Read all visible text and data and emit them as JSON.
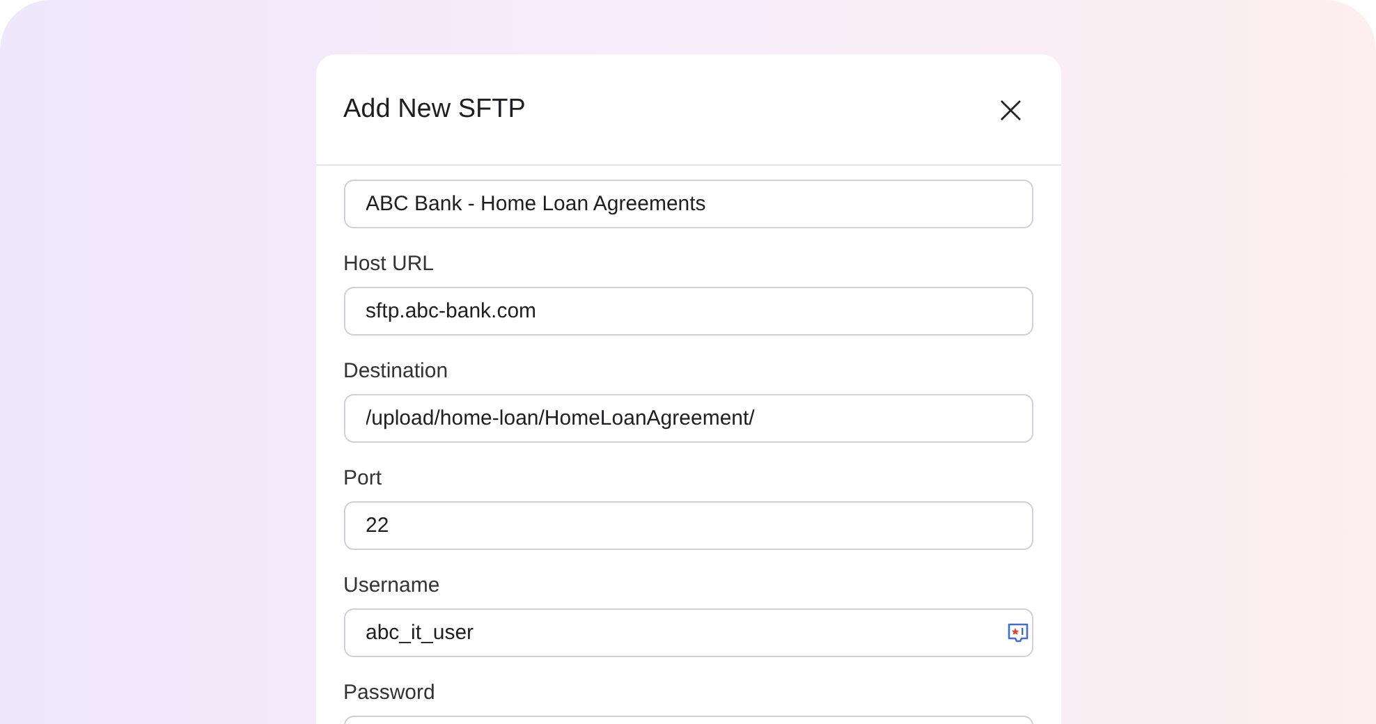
{
  "dialog": {
    "title": "Add New SFTP",
    "close_icon": "×"
  },
  "fields": [
    {
      "value": "ABC Bank - Home Loan Agreements",
      "autofill_icon": false
    },
    {
      "label": "Host URL",
      "value": "sftp.abc-bank.com",
      "autofill_icon": false
    },
    {
      "label": "Destination",
      "value": "/upload/home-loan/HomeLoanAgreement/",
      "autofill_icon": false
    },
    {
      "label": "Port",
      "value": "22",
      "autofill_icon": false
    },
    {
      "label": "Username",
      "value": "abc_it_user",
      "autofill_icon": true
    },
    {
      "label": "Password",
      "autofill_icon": false
    }
  ]
}
